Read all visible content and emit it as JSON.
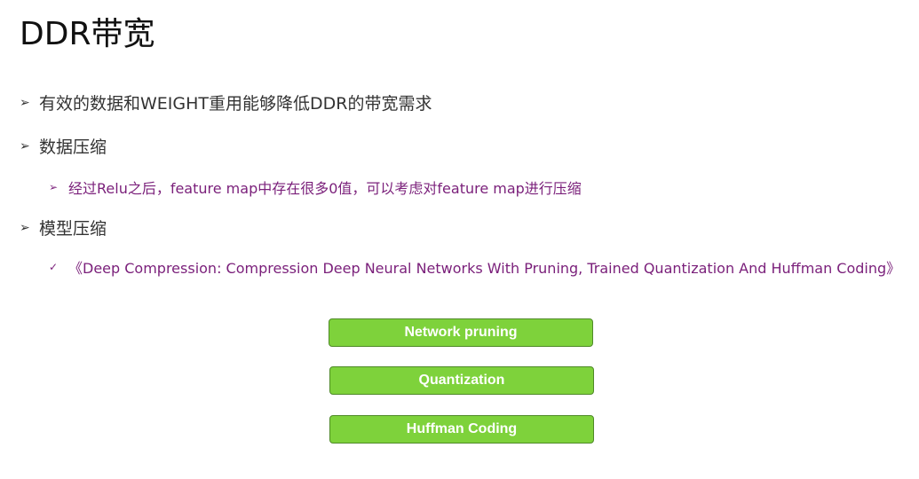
{
  "slide": {
    "title": "DDR带宽"
  },
  "bullets": [
    {
      "marker": "➢",
      "text": "有效的数据和WEIGHT重用能够降低DDR的带宽需求"
    },
    {
      "marker": "➢",
      "text": "数据压缩"
    },
    {
      "marker": "➢",
      "text": "经过Relu之后，feature map中存在很多0值，可以考虑对feature map进行压缩"
    },
    {
      "marker": "➢",
      "text": "模型压缩"
    },
    {
      "marker": "✓",
      "text": "《Deep Compression: Compression Deep Neural Networks With Pruning, Trained Quantization And Huffman Coding》"
    }
  ],
  "pipeline": {
    "color": "#7ed23b",
    "steps": [
      {
        "label": "Network pruning"
      },
      {
        "label": "Quantization"
      },
      {
        "label": "Huffman Coding"
      }
    ]
  }
}
